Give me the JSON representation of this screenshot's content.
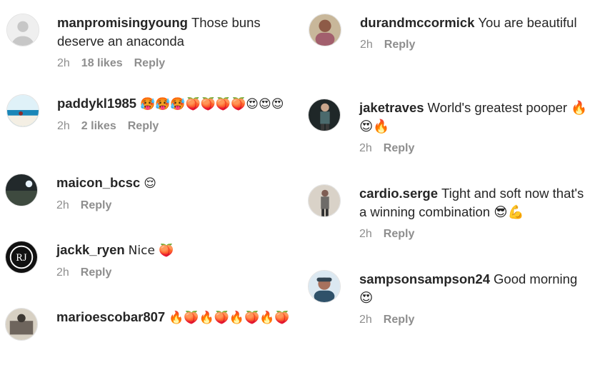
{
  "comments_left": [
    {
      "username": "manpromisingyoung",
      "text": "Those buns deserve an anaconda",
      "time": "2h",
      "likes": "18 likes",
      "reply": "Reply"
    },
    {
      "username": "paddykl1985",
      "text": "🥵🥵🥵🍑🍑🍑🍑😍😍😍",
      "time": "2h",
      "likes": "2 likes",
      "reply": "Reply"
    },
    {
      "username": "maicon_bcsc",
      "text": "😌",
      "time": "2h",
      "likes": "",
      "reply": "Reply"
    },
    {
      "username": "jackk_ryen",
      "text": "Nice 🍑",
      "time": "2h",
      "likes": "",
      "reply": "Reply"
    },
    {
      "username": "marioescobar807",
      "text": "🔥🍑🔥🍑🔥🍑🔥🍑",
      "time": "",
      "likes": "",
      "reply": ""
    }
  ],
  "comments_right": [
    {
      "username": "durandmccormick",
      "text": "You are beautiful",
      "time": "2h",
      "likes": "",
      "reply": "Reply"
    },
    {
      "username": "jaketraves",
      "text": "World's greatest pooper 🔥😍🔥",
      "time": "2h",
      "likes": "",
      "reply": "Reply"
    },
    {
      "username": "cardio.serge",
      "text": "Tight and soft now that's a winning combination 😎💪",
      "time": "2h",
      "likes": "",
      "reply": "Reply"
    },
    {
      "username": "sampsonsampson24",
      "text": "Good morning 😍",
      "time": "2h",
      "likes": "",
      "reply": "Reply"
    }
  ],
  "avatar_icons": {
    "default": "default-avatar-icon",
    "logo": "rj-logo-icon"
  }
}
